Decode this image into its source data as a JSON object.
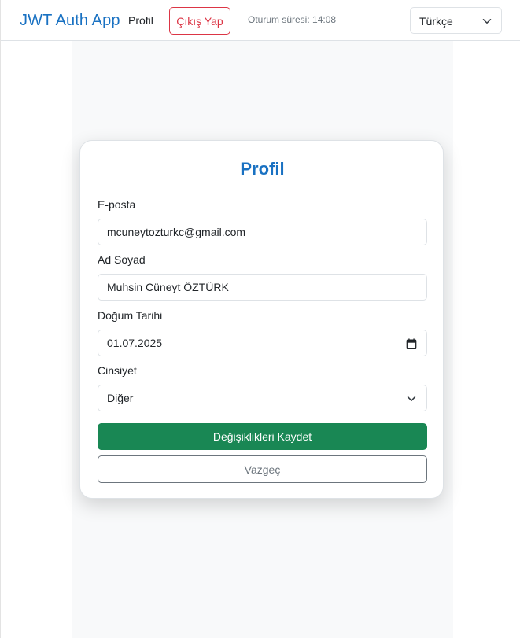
{
  "navbar": {
    "brand": "JWT Auth App",
    "profile_link": "Profil",
    "logout_label": "Çıkış Yap",
    "session_text": "Oturum süresi: 14:08",
    "language_selected": "Türkçe"
  },
  "form": {
    "title": "Profil",
    "email": {
      "label": "E-posta",
      "value": "mcuneytozturkc@gmail.com"
    },
    "fullname": {
      "label": "Ad Soyad",
      "value": "Muhsin Cüneyt ÖZTÜRK"
    },
    "birthdate": {
      "label": "Doğum Tarihi",
      "value": "01.07.2025",
      "icon": "calendar-icon"
    },
    "gender": {
      "label": "Cinsiyet",
      "value": "Diğer",
      "icon": "chevron-down-icon"
    },
    "save_label": "Değişiklikleri Kaydet",
    "cancel_label": "Vazgeç"
  },
  "colors": {
    "brand": "#1971c2",
    "danger": "#dc3545",
    "success": "#198754",
    "secondary": "#6c757d",
    "page_column": "#f8f9fa"
  }
}
